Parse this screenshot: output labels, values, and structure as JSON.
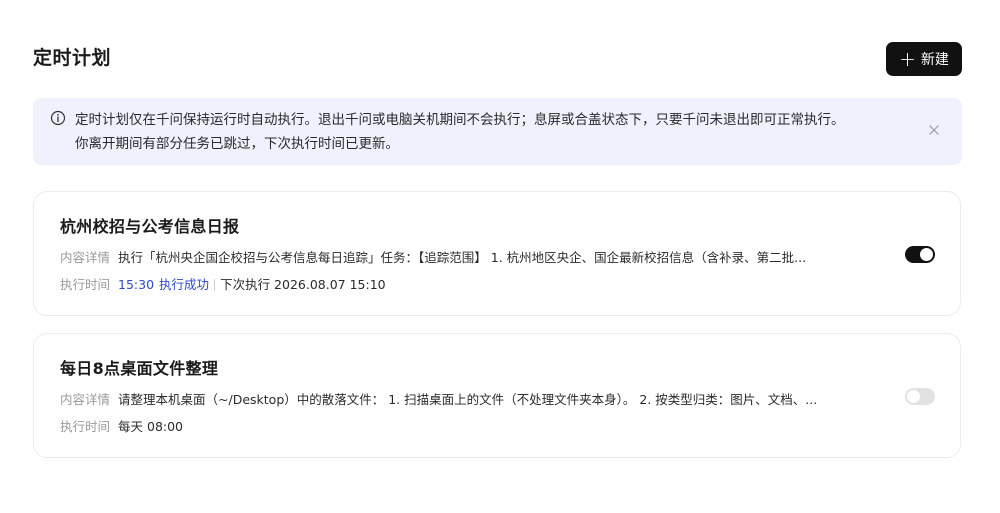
{
  "header": {
    "title": "定时计划",
    "new_button_icon": "plus-icon",
    "new_button_label": "新建"
  },
  "notice": {
    "icon": "info-icon",
    "line1": "定时计划仅在千问保持运行时自动执行。退出千问或电脑关机期间不会执行；息屏或合盖状态下，只要千问未退出即可正常执行。",
    "line2": "你离开期间有部分任务已跳过，下次执行时间已更新。",
    "close_icon": "close-icon"
  },
  "plans": [
    {
      "title": "杭州校招与公考信息日报",
      "detail_label": "内容详情",
      "detail_value": "执行「杭州央企国企校招与公考信息每日追踪」任务：【追踪范围】 1. 杭州地区央企、国企最新校招信息（含补录、第二批...",
      "time_label": "执行时间",
      "last_run_time": "15:30",
      "last_run_status": "执行成功",
      "next_run": "下次执行 2026.08.07 15:10",
      "enabled": true
    },
    {
      "title": "每日8点桌面文件整理",
      "detail_label": "内容详情",
      "detail_value": "请整理本机桌面（~/Desktop）中的散落文件： 1. 扫描桌面上的文件（不处理文件夹本身）。 2. 按类型归类：图片、文档、...",
      "time_label": "执行时间",
      "schedule": "每天 08:00",
      "enabled": false
    }
  ],
  "colors": {
    "accent_blue": "#2f49d1",
    "notice_bg": "#eff2fd",
    "button_bg": "#111111"
  }
}
